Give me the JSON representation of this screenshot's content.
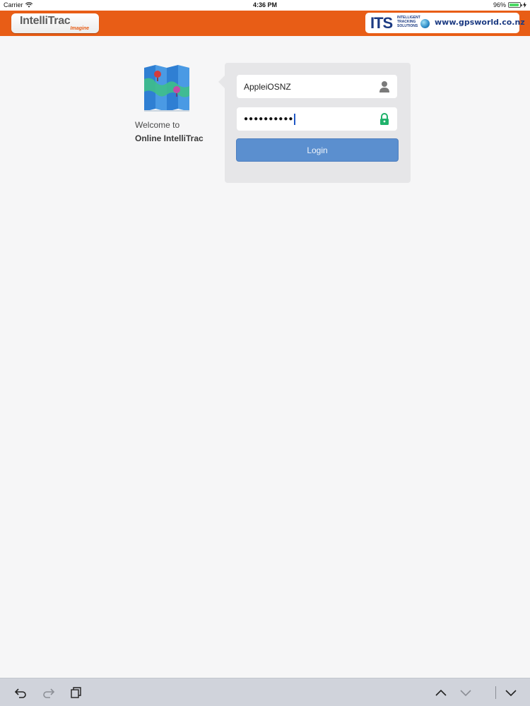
{
  "status_bar": {
    "carrier": "Carrier",
    "time": "4:36 PM",
    "battery_percent": "96%",
    "battery_level": 0.96
  },
  "header": {
    "app_logo": "IntelliTrac",
    "app_logo_sub": "Imagine",
    "partner_logo_mark": "ITS",
    "partner_logo_words": [
      "INTELLIGENT",
      "TRACKING",
      "SOLUTIONS"
    ],
    "partner_website": "www.gpsworld.co.nz",
    "bar_color": "#e85d16"
  },
  "welcome": {
    "line1": "Welcome to",
    "app_name": "Online IntelliTrac"
  },
  "login": {
    "username_value": "AppleiOSNZ",
    "password_masked": "●●●●●●●●●●",
    "login_label": "Login",
    "button_color": "#5b8fcf",
    "lock_icon_color": "#20b26b"
  },
  "icons": {
    "username_icon": "user-icon",
    "password_icon": "lock-icon",
    "undo": "undo-icon",
    "redo": "redo-icon",
    "paste": "clipboard-icon",
    "prev": "chevron-up-icon",
    "next": "chevron-down-icon",
    "dismiss": "keyboard-dismiss-icon"
  }
}
